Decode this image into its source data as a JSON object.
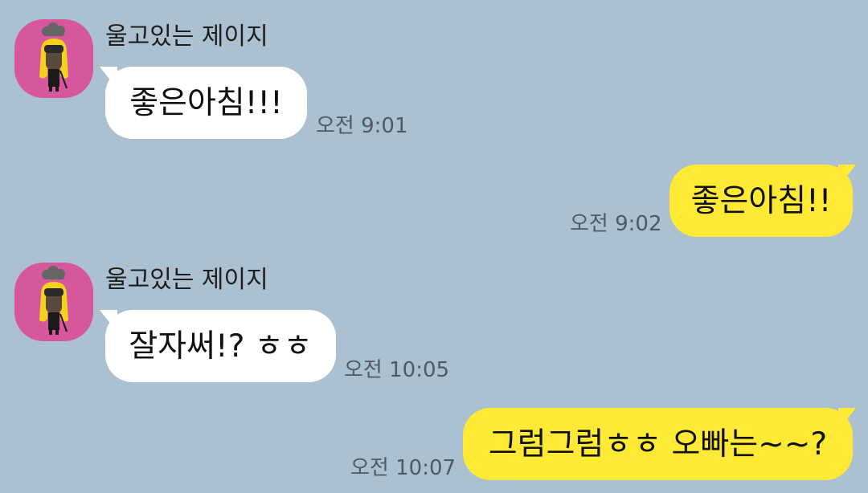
{
  "messages": [
    {
      "direction": "incoming",
      "sender": "울고있는 제이지",
      "text": "좋은아침!!!",
      "time": "오전 9:01",
      "avatar_icon": "jay-g-character-avatar-icon"
    },
    {
      "direction": "outgoing",
      "text": "좋은아침!!",
      "time": "오전 9:02"
    },
    {
      "direction": "incoming",
      "sender": "울고있는 제이지",
      "text": "잘자써!? ㅎㅎ",
      "time": "오전 10:05",
      "avatar_icon": "jay-g-character-avatar-icon"
    },
    {
      "direction": "outgoing",
      "text": "그럼그럼ㅎㅎ 오빠는~~?",
      "time": "오전 10:07"
    }
  ],
  "colors": {
    "background": "#abc1d1",
    "incoming_bubble": "#ffffff",
    "outgoing_bubble": "#fee934",
    "avatar_background": "#d6579b"
  }
}
